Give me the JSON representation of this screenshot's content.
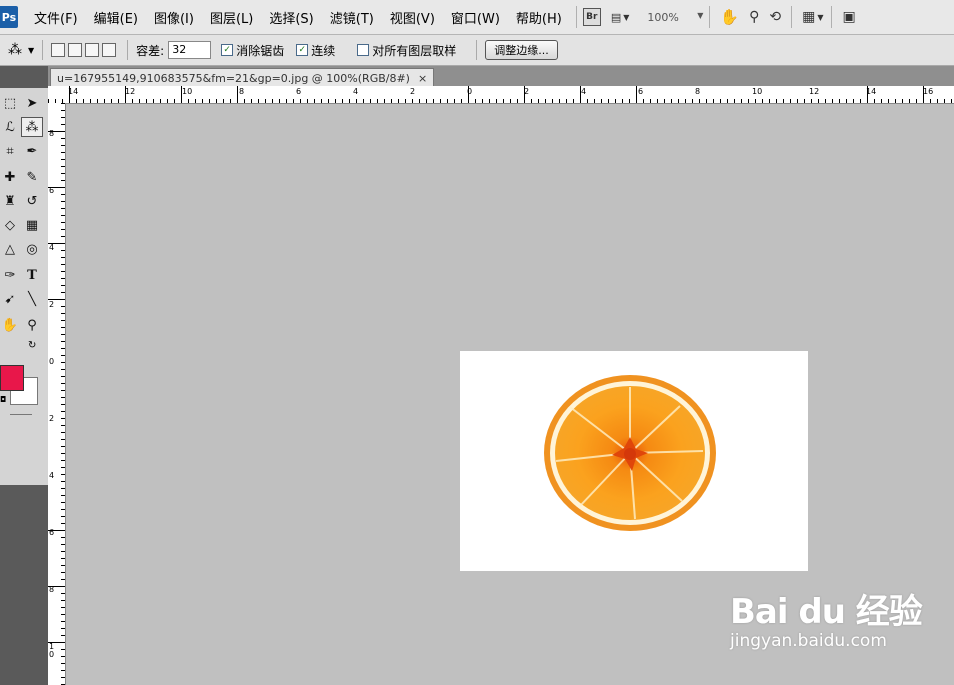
{
  "app": {
    "logo": "Ps"
  },
  "menu": [
    "文件(F)",
    "编辑(E)",
    "图像(I)",
    "图层(L)",
    "选择(S)",
    "滤镜(T)",
    "视图(V)",
    "窗口(W)",
    "帮助(H)"
  ],
  "menubar_tools": {
    "bridge_label": "Br",
    "zoom": "100%"
  },
  "options": {
    "tolerance_label": "容差:",
    "tolerance_value": "32",
    "antialias_label": "消除锯齿",
    "contiguous_label": "连续",
    "sample_all_label": "对所有图层取样",
    "refine_edge_label": "调整边缘..."
  },
  "document": {
    "tab_title": "u=167955149,910683575&fm=21&gp=0.jpg @ 100%(RGB/8#)",
    "close_symbol": "×"
  },
  "ruler": {
    "h_labels": [
      "14",
      "12",
      "10",
      "8",
      "6",
      "4",
      "2",
      "0",
      "2",
      "4",
      "6",
      "8",
      "10",
      "12",
      "14",
      "16"
    ],
    "v_labels": [
      "8",
      "6",
      "4",
      "2",
      "0",
      "2",
      "4",
      "6",
      "8",
      "10"
    ]
  },
  "colors": {
    "foreground": "#e8174a",
    "background": "#ffffff"
  },
  "watermark": {
    "main": "Bai du 经验",
    "sub": "jingyan.baidu.com"
  }
}
